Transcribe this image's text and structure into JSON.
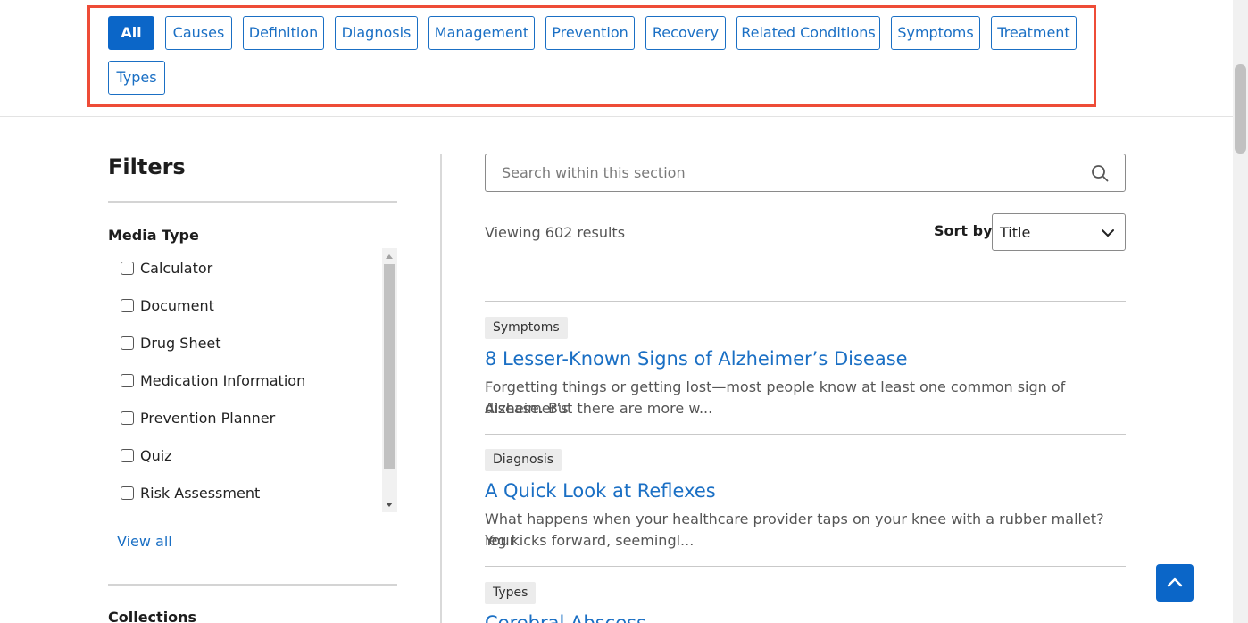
{
  "tags": {
    "items": [
      "All",
      "Causes",
      "Definition",
      "Diagnosis",
      "Management",
      "Prevention",
      "Recovery",
      "Related Conditions",
      "Symptoms",
      "Treatment",
      "Types"
    ],
    "active": "All",
    "active_color": "#0b66c8",
    "highlight_color": "#ee4c37"
  },
  "filters": {
    "title": "Filters",
    "media_type": {
      "title": "Media Type",
      "options": [
        "Calculator",
        "Document",
        "Drug Sheet",
        "Medication Information",
        "Prevention Planner",
        "Quiz",
        "Risk Assessment"
      ]
    },
    "view_all": "View all",
    "collections_title": "Collections"
  },
  "search": {
    "placeholder": "Search within this section",
    "icon": "search-icon"
  },
  "results": {
    "count_text": "Viewing 602 results",
    "sort_label": "Sort by",
    "sort_value": "Title",
    "items": [
      {
        "badge": "Symptoms",
        "title": "8 Lesser-Known Signs of Alzheimer’s Disease",
        "desc1": "Forgetting things or getting lost—most people know at least one common sign of Alzheimer’s",
        "desc2": "disease. But there are more w..."
      },
      {
        "badge": "Diagnosis",
        "title": "A Quick Look at Reflexes",
        "desc1": "What happens when your healthcare provider taps on your knee with a rubber mallet? Your",
        "desc2": "leg kicks forward, seemingl..."
      },
      {
        "badge": "Types",
        "title": "Cerebral Abscess",
        "desc1": "",
        "desc2": ""
      }
    ]
  },
  "back_to_top_icon": "chevron-up-icon",
  "link_color": "#1a6fc4"
}
